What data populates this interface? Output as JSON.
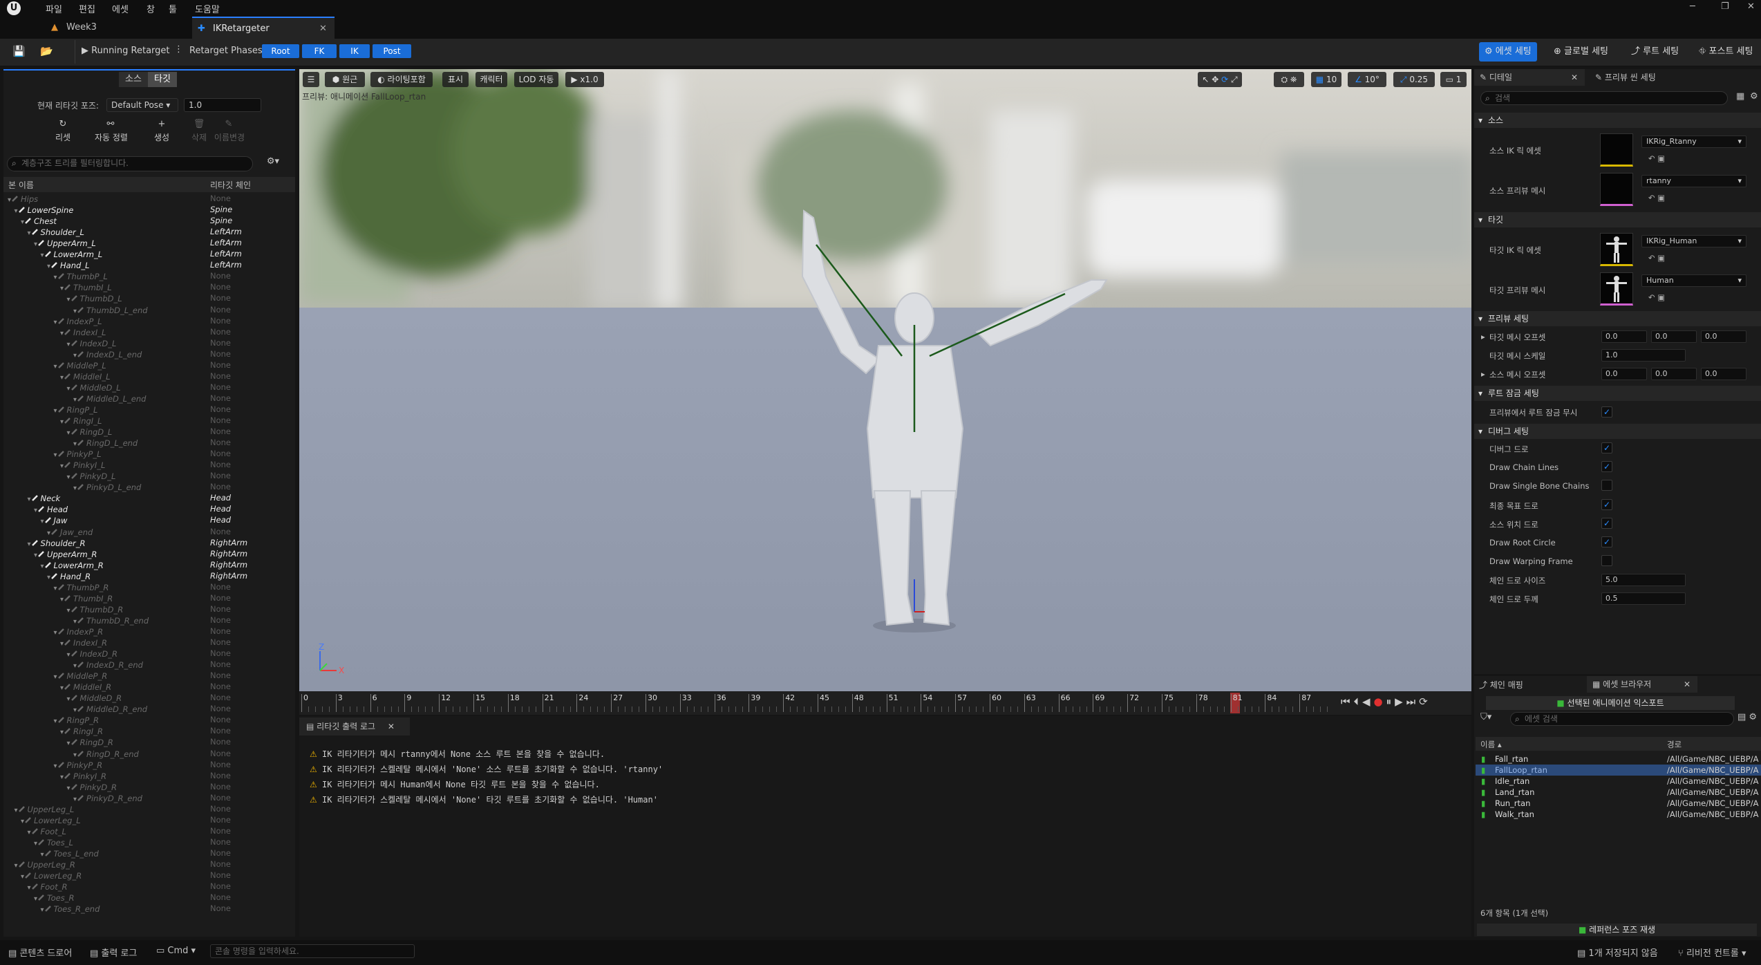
{
  "menu": {
    "items": [
      "파일",
      "편집",
      "에셋",
      "창",
      "툴",
      "도움말"
    ]
  },
  "tabs": [
    {
      "label": "Week3"
    },
    {
      "label": "IKRetargeter"
    }
  ],
  "toolbar": {
    "running": "Running Retarget",
    "phases_label": "Retarget Phases:",
    "phases": [
      "Root",
      "FK",
      "IK",
      "Post"
    ],
    "right_buttons": [
      "에셋 세팅",
      "글로벌 세팅",
      "루트 세팅",
      "포스트 세팅"
    ]
  },
  "left": {
    "seg": [
      "소스",
      "타깃"
    ],
    "pose_label": "현재 리타깃 포즈:",
    "pose_value": "Default Pose",
    "pose_num": "1.0",
    "tools": [
      "리셋",
      "자동 정렬",
      "생성",
      "삭제",
      "이름변경"
    ],
    "search_placeholder": "계층구조 트리를 필터링합니다.",
    "col_bone": "본 이름",
    "col_chain": "리타깃 체인",
    "rows": [
      {
        "d": 0,
        "n": "Hips",
        "c": "None",
        "dim": true
      },
      {
        "d": 1,
        "n": "LowerSpine",
        "c": "Spine"
      },
      {
        "d": 2,
        "n": "Chest",
        "c": "Spine"
      },
      {
        "d": 3,
        "n": "Shoulder_L",
        "c": "LeftArm"
      },
      {
        "d": 4,
        "n": "UpperArm_L",
        "c": "LeftArm"
      },
      {
        "d": 5,
        "n": "LowerArm_L",
        "c": "LeftArm"
      },
      {
        "d": 6,
        "n": "Hand_L",
        "c": "LeftArm"
      },
      {
        "d": 7,
        "n": "ThumbP_L",
        "c": "None",
        "dim": true
      },
      {
        "d": 8,
        "n": "ThumbI_L",
        "c": "None",
        "dim": true
      },
      {
        "d": 9,
        "n": "ThumbD_L",
        "c": "None",
        "dim": true
      },
      {
        "d": 10,
        "n": "ThumbD_L_end",
        "c": "None",
        "dim": true
      },
      {
        "d": 7,
        "n": "IndexP_L",
        "c": "None",
        "dim": true
      },
      {
        "d": 8,
        "n": "IndexI_L",
        "c": "None",
        "dim": true
      },
      {
        "d": 9,
        "n": "IndexD_L",
        "c": "None",
        "dim": true
      },
      {
        "d": 10,
        "n": "IndexD_L_end",
        "c": "None",
        "dim": true
      },
      {
        "d": 7,
        "n": "MiddleP_L",
        "c": "None",
        "dim": true
      },
      {
        "d": 8,
        "n": "MiddleI_L",
        "c": "None",
        "dim": true
      },
      {
        "d": 9,
        "n": "MiddleD_L",
        "c": "None",
        "dim": true
      },
      {
        "d": 10,
        "n": "MiddleD_L_end",
        "c": "None",
        "dim": true
      },
      {
        "d": 7,
        "n": "RingP_L",
        "c": "None",
        "dim": true
      },
      {
        "d": 8,
        "n": "RingI_L",
        "c": "None",
        "dim": true
      },
      {
        "d": 9,
        "n": "RingD_L",
        "c": "None",
        "dim": true
      },
      {
        "d": 10,
        "n": "RingD_L_end",
        "c": "None",
        "dim": true
      },
      {
        "d": 7,
        "n": "PinkyP_L",
        "c": "None",
        "dim": true
      },
      {
        "d": 8,
        "n": "PinkyI_L",
        "c": "None",
        "dim": true
      },
      {
        "d": 9,
        "n": "PinkyD_L",
        "c": "None",
        "dim": true
      },
      {
        "d": 10,
        "n": "PinkyD_L_end",
        "c": "None",
        "dim": true
      },
      {
        "d": 3,
        "n": "Neck",
        "c": "Head"
      },
      {
        "d": 4,
        "n": "Head",
        "c": "Head"
      },
      {
        "d": 5,
        "n": "Jaw",
        "c": "Head"
      },
      {
        "d": 6,
        "n": "Jaw_end",
        "c": "None",
        "dim": true
      },
      {
        "d": 3,
        "n": "Shoulder_R",
        "c": "RightArm"
      },
      {
        "d": 4,
        "n": "UpperArm_R",
        "c": "RightArm"
      },
      {
        "d": 5,
        "n": "LowerArm_R",
        "c": "RightArm"
      },
      {
        "d": 6,
        "n": "Hand_R",
        "c": "RightArm"
      },
      {
        "d": 7,
        "n": "ThumbP_R",
        "c": "None",
        "dim": true
      },
      {
        "d": 8,
        "n": "ThumbI_R",
        "c": "None",
        "dim": true
      },
      {
        "d": 9,
        "n": "ThumbD_R",
        "c": "None",
        "dim": true
      },
      {
        "d": 10,
        "n": "ThumbD_R_end",
        "c": "None",
        "dim": true
      },
      {
        "d": 7,
        "n": "IndexP_R",
        "c": "None",
        "dim": true
      },
      {
        "d": 8,
        "n": "IndexI_R",
        "c": "None",
        "dim": true
      },
      {
        "d": 9,
        "n": "IndexD_R",
        "c": "None",
        "dim": true
      },
      {
        "d": 10,
        "n": "IndexD_R_end",
        "c": "None",
        "dim": true
      },
      {
        "d": 7,
        "n": "MiddleP_R",
        "c": "None",
        "dim": true
      },
      {
        "d": 8,
        "n": "MiddleI_R",
        "c": "None",
        "dim": true
      },
      {
        "d": 9,
        "n": "MiddleD_R",
        "c": "None",
        "dim": true
      },
      {
        "d": 10,
        "n": "MiddleD_R_end",
        "c": "None",
        "dim": true
      },
      {
        "d": 7,
        "n": "RingP_R",
        "c": "None",
        "dim": true
      },
      {
        "d": 8,
        "n": "RingI_R",
        "c": "None",
        "dim": true
      },
      {
        "d": 9,
        "n": "RingD_R",
        "c": "None",
        "dim": true
      },
      {
        "d": 10,
        "n": "RingD_R_end",
        "c": "None",
        "dim": true
      },
      {
        "d": 7,
        "n": "PinkyP_R",
        "c": "None",
        "dim": true
      },
      {
        "d": 8,
        "n": "PinkyI_R",
        "c": "None",
        "dim": true
      },
      {
        "d": 9,
        "n": "PinkyD_R",
        "c": "None",
        "dim": true
      },
      {
        "d": 10,
        "n": "PinkyD_R_end",
        "c": "None",
        "dim": true
      },
      {
        "d": 1,
        "n": "UpperLeg_L",
        "c": "None",
        "dim": true
      },
      {
        "d": 2,
        "n": "LowerLeg_L",
        "c": "None",
        "dim": true
      },
      {
        "d": 3,
        "n": "Foot_L",
        "c": "None",
        "dim": true
      },
      {
        "d": 4,
        "n": "Toes_L",
        "c": "None",
        "dim": true
      },
      {
        "d": 5,
        "n": "Toes_L_end",
        "c": "None",
        "dim": true
      },
      {
        "d": 1,
        "n": "UpperLeg_R",
        "c": "None",
        "dim": true
      },
      {
        "d": 2,
        "n": "LowerLeg_R",
        "c": "None",
        "dim": true
      },
      {
        "d": 3,
        "n": "Foot_R",
        "c": "None",
        "dim": true
      },
      {
        "d": 4,
        "n": "Toes_R",
        "c": "None",
        "dim": true
      },
      {
        "d": 5,
        "n": "Toes_R_end",
        "c": "None",
        "dim": true
      }
    ]
  },
  "viewport": {
    "buttons": [
      "원근",
      "라이팅포함",
      "표시",
      "캐릭터",
      "LOD 자동",
      "x1.0"
    ],
    "caption": "프리뷰: 애니메이션 FallLoop_rtan",
    "right_values": [
      "10",
      "10°",
      "0.25",
      "1"
    ]
  },
  "timeline": {
    "ticks": [
      "0",
      "3",
      "6",
      "9",
      "12",
      "15",
      "18",
      "21",
      "24",
      "27",
      "30",
      "33",
      "36",
      "39",
      "42",
      "45",
      "48",
      "51",
      "54",
      "57",
      "60",
      "63",
      "66",
      "69",
      "72",
      "75",
      "78",
      "81",
      "84",
      "87"
    ],
    "current": "81"
  },
  "log": {
    "tab": "리타깃 출력 로그",
    "lines": [
      "IK 리타기터가 메시 rtanny에서 None 소스 루트 본을 찾을 수 없습니다.",
      "IK 리타기터가 스켈레탈 메시에서 'None' 소스 루트를 초기화할 수 없습니다. 'rtanny'",
      "IK 리타기터가 메시 Human에서 None 타깃 루트 본을 찾을 수 없습니다.",
      "IK 리타기터가 스켈레탈 메시에서 'None' 타깃 루트를 초기화할 수 없습니다. 'Human'"
    ]
  },
  "details": {
    "tab": "디테일",
    "tab2": "프리뷰 씬 세팅",
    "search_placeholder": "검색",
    "sec_source": "소스",
    "src_ik": "소스 IK 릭 에셋",
    "src_ik_val": "IKRig_Rtanny",
    "src_mesh": "소스 프리뷰 메시",
    "src_mesh_val": "rtanny",
    "sec_target": "타깃",
    "tgt_ik": "타깃 IK 릭 에셋",
    "tgt_ik_val": "IKRig_Human",
    "tgt_mesh": "타깃 프리뷰 메시",
    "tgt_mesh_val": "Human",
    "sec_preview": "프리뷰 세팅",
    "tgt_offset": "타깃 메시 오프셋",
    "tgt_scale": "타깃 메시 스케일",
    "src_offset": "소스 메시 오프셋",
    "offset_vals": [
      "0.0",
      "0.0",
      "0.0"
    ],
    "scale_val": "1.0",
    "sec_root": "루트 잠금 세팅",
    "root_ignore": "프리뷰에서 루트 잠금 무시",
    "sec_debug": "디버그 세팅",
    "debug": [
      {
        "l": "디버그 드로",
        "c": true
      },
      {
        "l": "Draw Chain Lines",
        "c": true
      },
      {
        "l": "Draw Single Bone Chains",
        "c": false
      },
      {
        "l": "최종 목표 드로",
        "c": true
      },
      {
        "l": "소스 위치 드로",
        "c": true
      },
      {
        "l": "Draw Root Circle",
        "c": true
      },
      {
        "l": "Draw Warping Frame",
        "c": false
      }
    ],
    "chain_size": "체인 드로 사이즈",
    "chain_size_val": "5.0",
    "chain_thick": "체인 드로 두께",
    "chain_thick_val": "0.5"
  },
  "assets": {
    "tab1": "체인 매핑",
    "tab2": "에셋 브라우저",
    "export_btn": "선택된 애니메이션 익스포트",
    "search_placeholder": "에셋 검색",
    "col_name": "이름",
    "col_path": "경로",
    "items": [
      {
        "n": "Fall_rtan",
        "p": "/All/Game/NBC_UEBP/A"
      },
      {
        "n": "FallLoop_rtan",
        "p": "/All/Game/NBC_UEBP/A"
      },
      {
        "n": "Idle_rtan",
        "p": "/All/Game/NBC_UEBP/A"
      },
      {
        "n": "Land_rtan",
        "p": "/All/Game/NBC_UEBP/A"
      },
      {
        "n": "Run_rtan",
        "p": "/All/Game/NBC_UEBP/A"
      },
      {
        "n": "Walk_rtan",
        "p": "/All/Game/NBC_UEBP/A"
      }
    ],
    "count": "6개 항목 (1개 선택)",
    "ref_btn": "레퍼런스 포즈 재생"
  },
  "status": {
    "content_drawer": "콘텐츠 드로어",
    "output_log": "출력 로그",
    "cmd": "Cmd",
    "cmd_placeholder": "콘솔 명령을 입력하세요.",
    "unsaved": "1개 저장되지 않음",
    "revision": "리비전 컨트롤"
  },
  "colors": {
    "accent": "#1a6dd8",
    "tab_highlight": "#2a7fff",
    "warning": "#f0b400",
    "check": "#2a8cff"
  }
}
